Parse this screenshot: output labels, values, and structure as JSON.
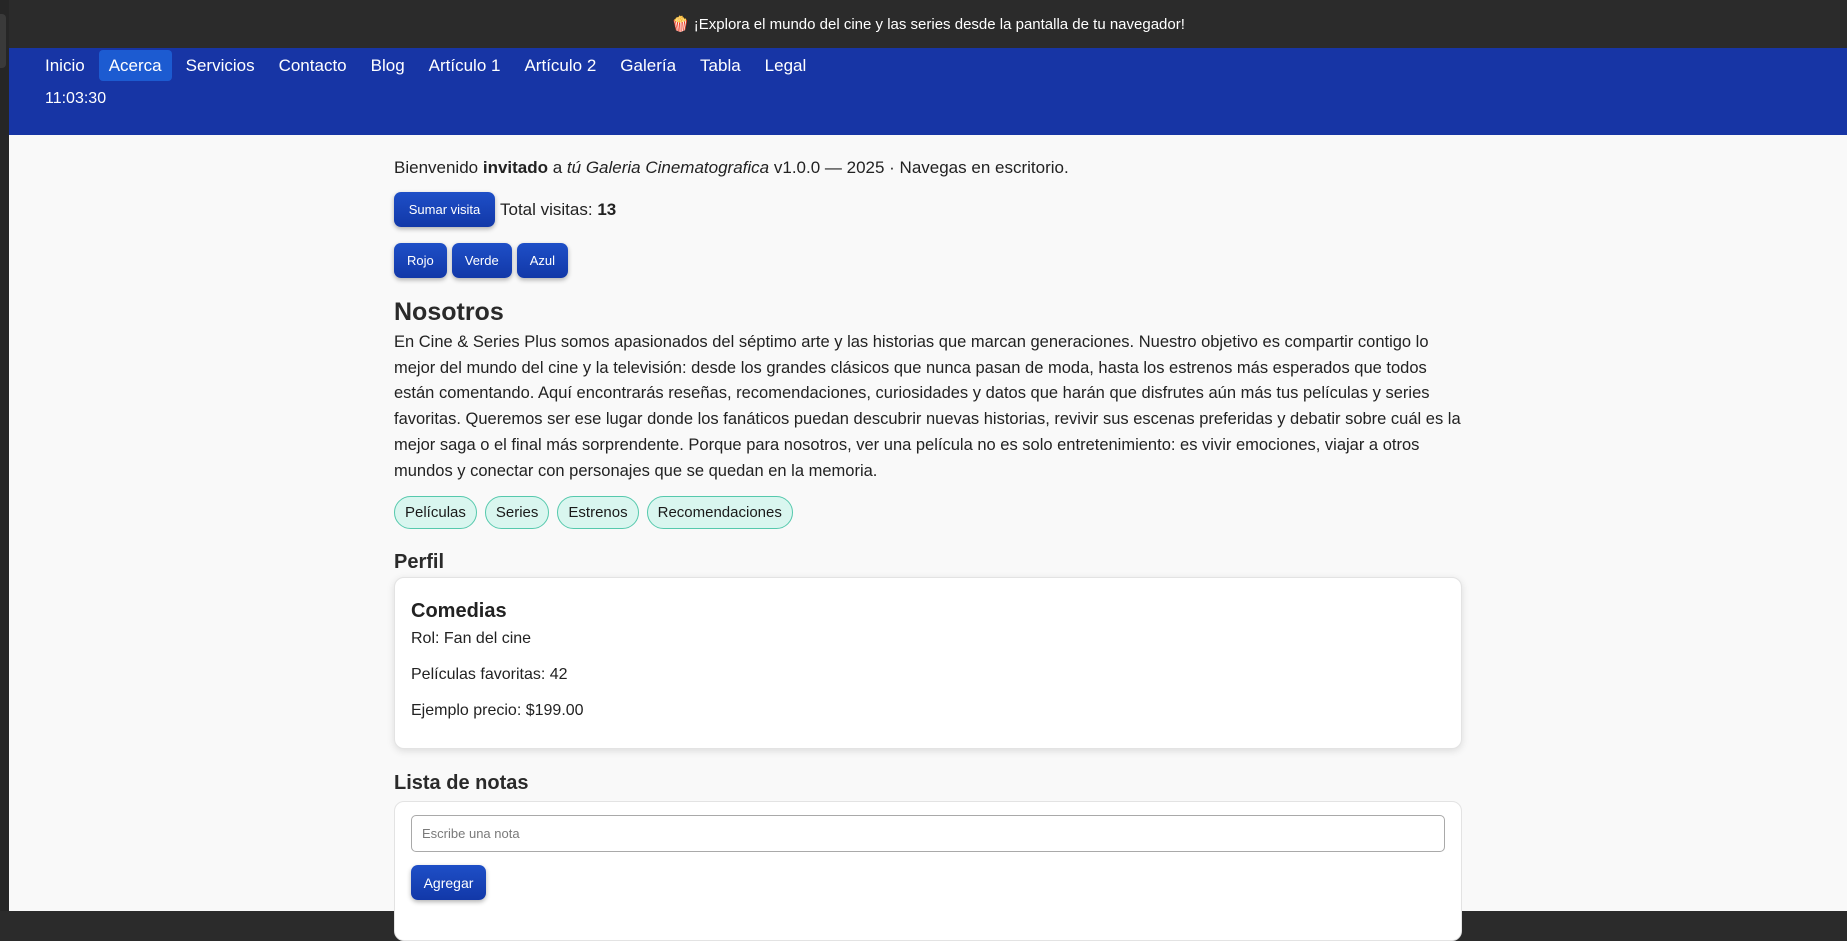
{
  "banner": {
    "icon": "popcorn-icon",
    "emoji": "🍿",
    "text": "¡Explora el mundo del cine y las series desde la pantalla de tu navegador!"
  },
  "nav": {
    "items": [
      {
        "label": "Inicio"
      },
      {
        "label": "Acerca",
        "active": true
      },
      {
        "label": "Servicios"
      },
      {
        "label": "Contacto"
      },
      {
        "label": "Blog"
      },
      {
        "label": "Artículo 1"
      },
      {
        "label": "Artículo 2"
      },
      {
        "label": "Galería"
      },
      {
        "label": "Tabla"
      },
      {
        "label": "Legal"
      }
    ],
    "time": "11:03:30"
  },
  "welcome": {
    "prefix": "Bienvenido ",
    "user": "invitado",
    "middle": " a ",
    "site": "tú Galeria Cinematografica",
    "suffix": " v1.0.0 — 2025 · Navegas en escritorio."
  },
  "visits": {
    "button_label": "Sumar visita",
    "label": "Total visitas: ",
    "count": "13"
  },
  "theme_buttons": [
    {
      "label": "Rojo"
    },
    {
      "label": "Verde"
    },
    {
      "label": "Azul"
    }
  ],
  "about": {
    "title": "Nosotros",
    "text": "En Cine & Series Plus somos apasionados del séptimo arte y las historias que marcan generaciones. Nuestro objetivo es compartir contigo lo mejor del mundo del cine y la televisión: desde los grandes clásicos que nunca pasan de moda, hasta los estrenos más esperados que todos están comentando. Aquí encontrarás reseñas, recomendaciones, curiosidades y datos que harán que disfrutes aún más tus películas y series favoritas. Queremos ser ese lugar donde los fanáticos puedan descubrir nuevas historias, revivir sus escenas preferidas y debatir sobre cuál es la mejor saga o el final más sorprendente. Porque para nosotros, ver una película no es solo entretenimiento: es vivir emociones, viajar a otros mundos y conectar con personajes que se quedan en la memoria.",
    "tags": [
      {
        "label": "Películas"
      },
      {
        "label": "Series"
      },
      {
        "label": "Estrenos"
      },
      {
        "label": "Recomendaciones"
      }
    ]
  },
  "profile": {
    "section_title": "Perfil",
    "card_title": "Comedias",
    "role": "Rol: Fan del cine",
    "favorites": "Películas favoritas: 42",
    "price": "Ejemplo precio: $199.00"
  },
  "notes": {
    "section_title": "Lista de notas",
    "input_value": "",
    "placeholder": "Escribe una nota",
    "add_label": "Agregar"
  },
  "colors": {
    "nav_bg": "#1735a5",
    "nav_active": "#1c5bd1",
    "button": "#1238a8",
    "tag_bg": "#d9f6ef",
    "tag_border": "#56c9ad",
    "topbar": "#2b2b2b"
  }
}
